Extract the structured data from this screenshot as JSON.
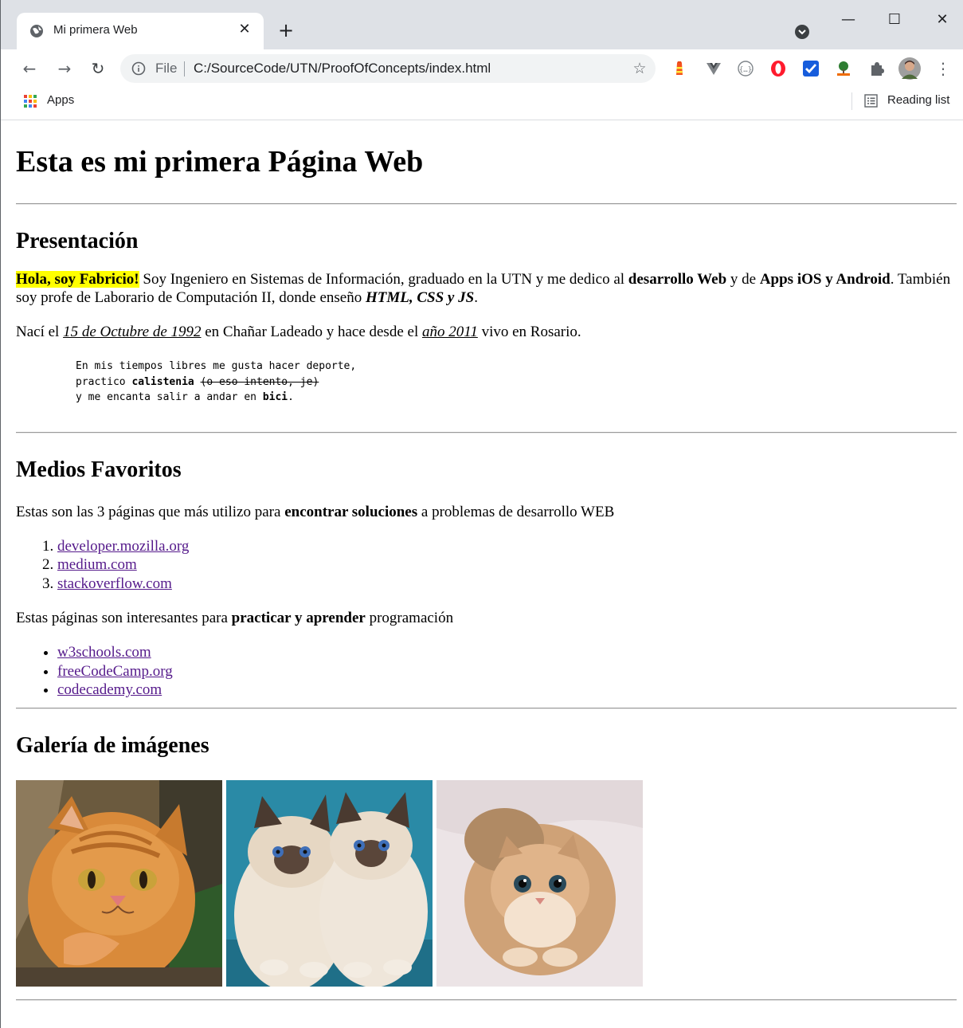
{
  "browser": {
    "tab": {
      "title": "Mi primera Web",
      "close": "✕"
    },
    "new_tab": "+",
    "window_controls": {
      "minimize": "—",
      "maximize": "☐",
      "close": "✕"
    },
    "nav": {
      "back": "←",
      "forward": "→",
      "reload": "↻"
    },
    "address": {
      "scheme": "File",
      "url": "C:/SourceCode/UTN/ProofOfConcepts/index.html"
    },
    "bookmark_star": "☆",
    "menu": "⋮",
    "bookmarks_bar": {
      "apps": "Apps",
      "reading_list": "Reading list"
    },
    "extensions": [
      "lighthouse-icon",
      "vue-devtools-icon",
      "json-viewer-icon",
      "opera-icon",
      "bitwarden-icon",
      "tree-icon",
      "extensions-puzzle-icon",
      "avatar"
    ]
  },
  "page": {
    "title": "Esta es mi primera Página Web",
    "presentation": {
      "heading": "Presentación",
      "greeting": "Hola, soy Fabricio!",
      "p1_a": " Soy Ingeniero en Sistemas de Información, graduado en la UTN y me dedico al ",
      "p1_b": "desarrollo Web",
      "p1_c": " y de ",
      "p1_d": "Apps iOS y Android",
      "p1_e": ". También soy profe de Laborario de Computación II, donde enseño ",
      "p1_f": "HTML, CSS y JS",
      "p1_g": ".",
      "p2_a": "Nací el ",
      "p2_date": "15 de Octubre de 1992",
      "p2_b": " en Chañar Ladeado y hace desde el ",
      "p2_year": "año 2011",
      "p2_c": " vivo en Rosario.",
      "pre_line1": "En mis tiempos libres me gusta hacer deporte,",
      "pre_line2_a": "practico ",
      "pre_line2_b": "calistenia",
      "pre_line2_c": " ",
      "pre_line2_d": "(o eso intento, je)",
      "pre_line3_a": "y me encanta salir a andar en ",
      "pre_line3_b": "bici",
      "pre_line3_c": "."
    },
    "media": {
      "heading": "Medios Favoritos",
      "intro_a": "Estas son las 3 páginas que más utilizo para ",
      "intro_b": "encontrar soluciones",
      "intro_c": " a problemas de desarrollo WEB",
      "ordered": [
        "developer.mozilla.org",
        "medium.com",
        "stackoverflow.com"
      ],
      "practice_a": "Estas páginas son interesantes para ",
      "practice_b": "practicar y aprender",
      "practice_c": " programación",
      "unordered": [
        "w3schools.com",
        "freeCodeCamp.org",
        "codecademy.com"
      ]
    },
    "gallery": {
      "heading": "Galería de imágenes"
    }
  },
  "colors": {
    "link_visited": "#551a8b",
    "highlight": "#ffff00",
    "titlebar": "#dee1e6",
    "omnibox": "#f1f3f4"
  }
}
